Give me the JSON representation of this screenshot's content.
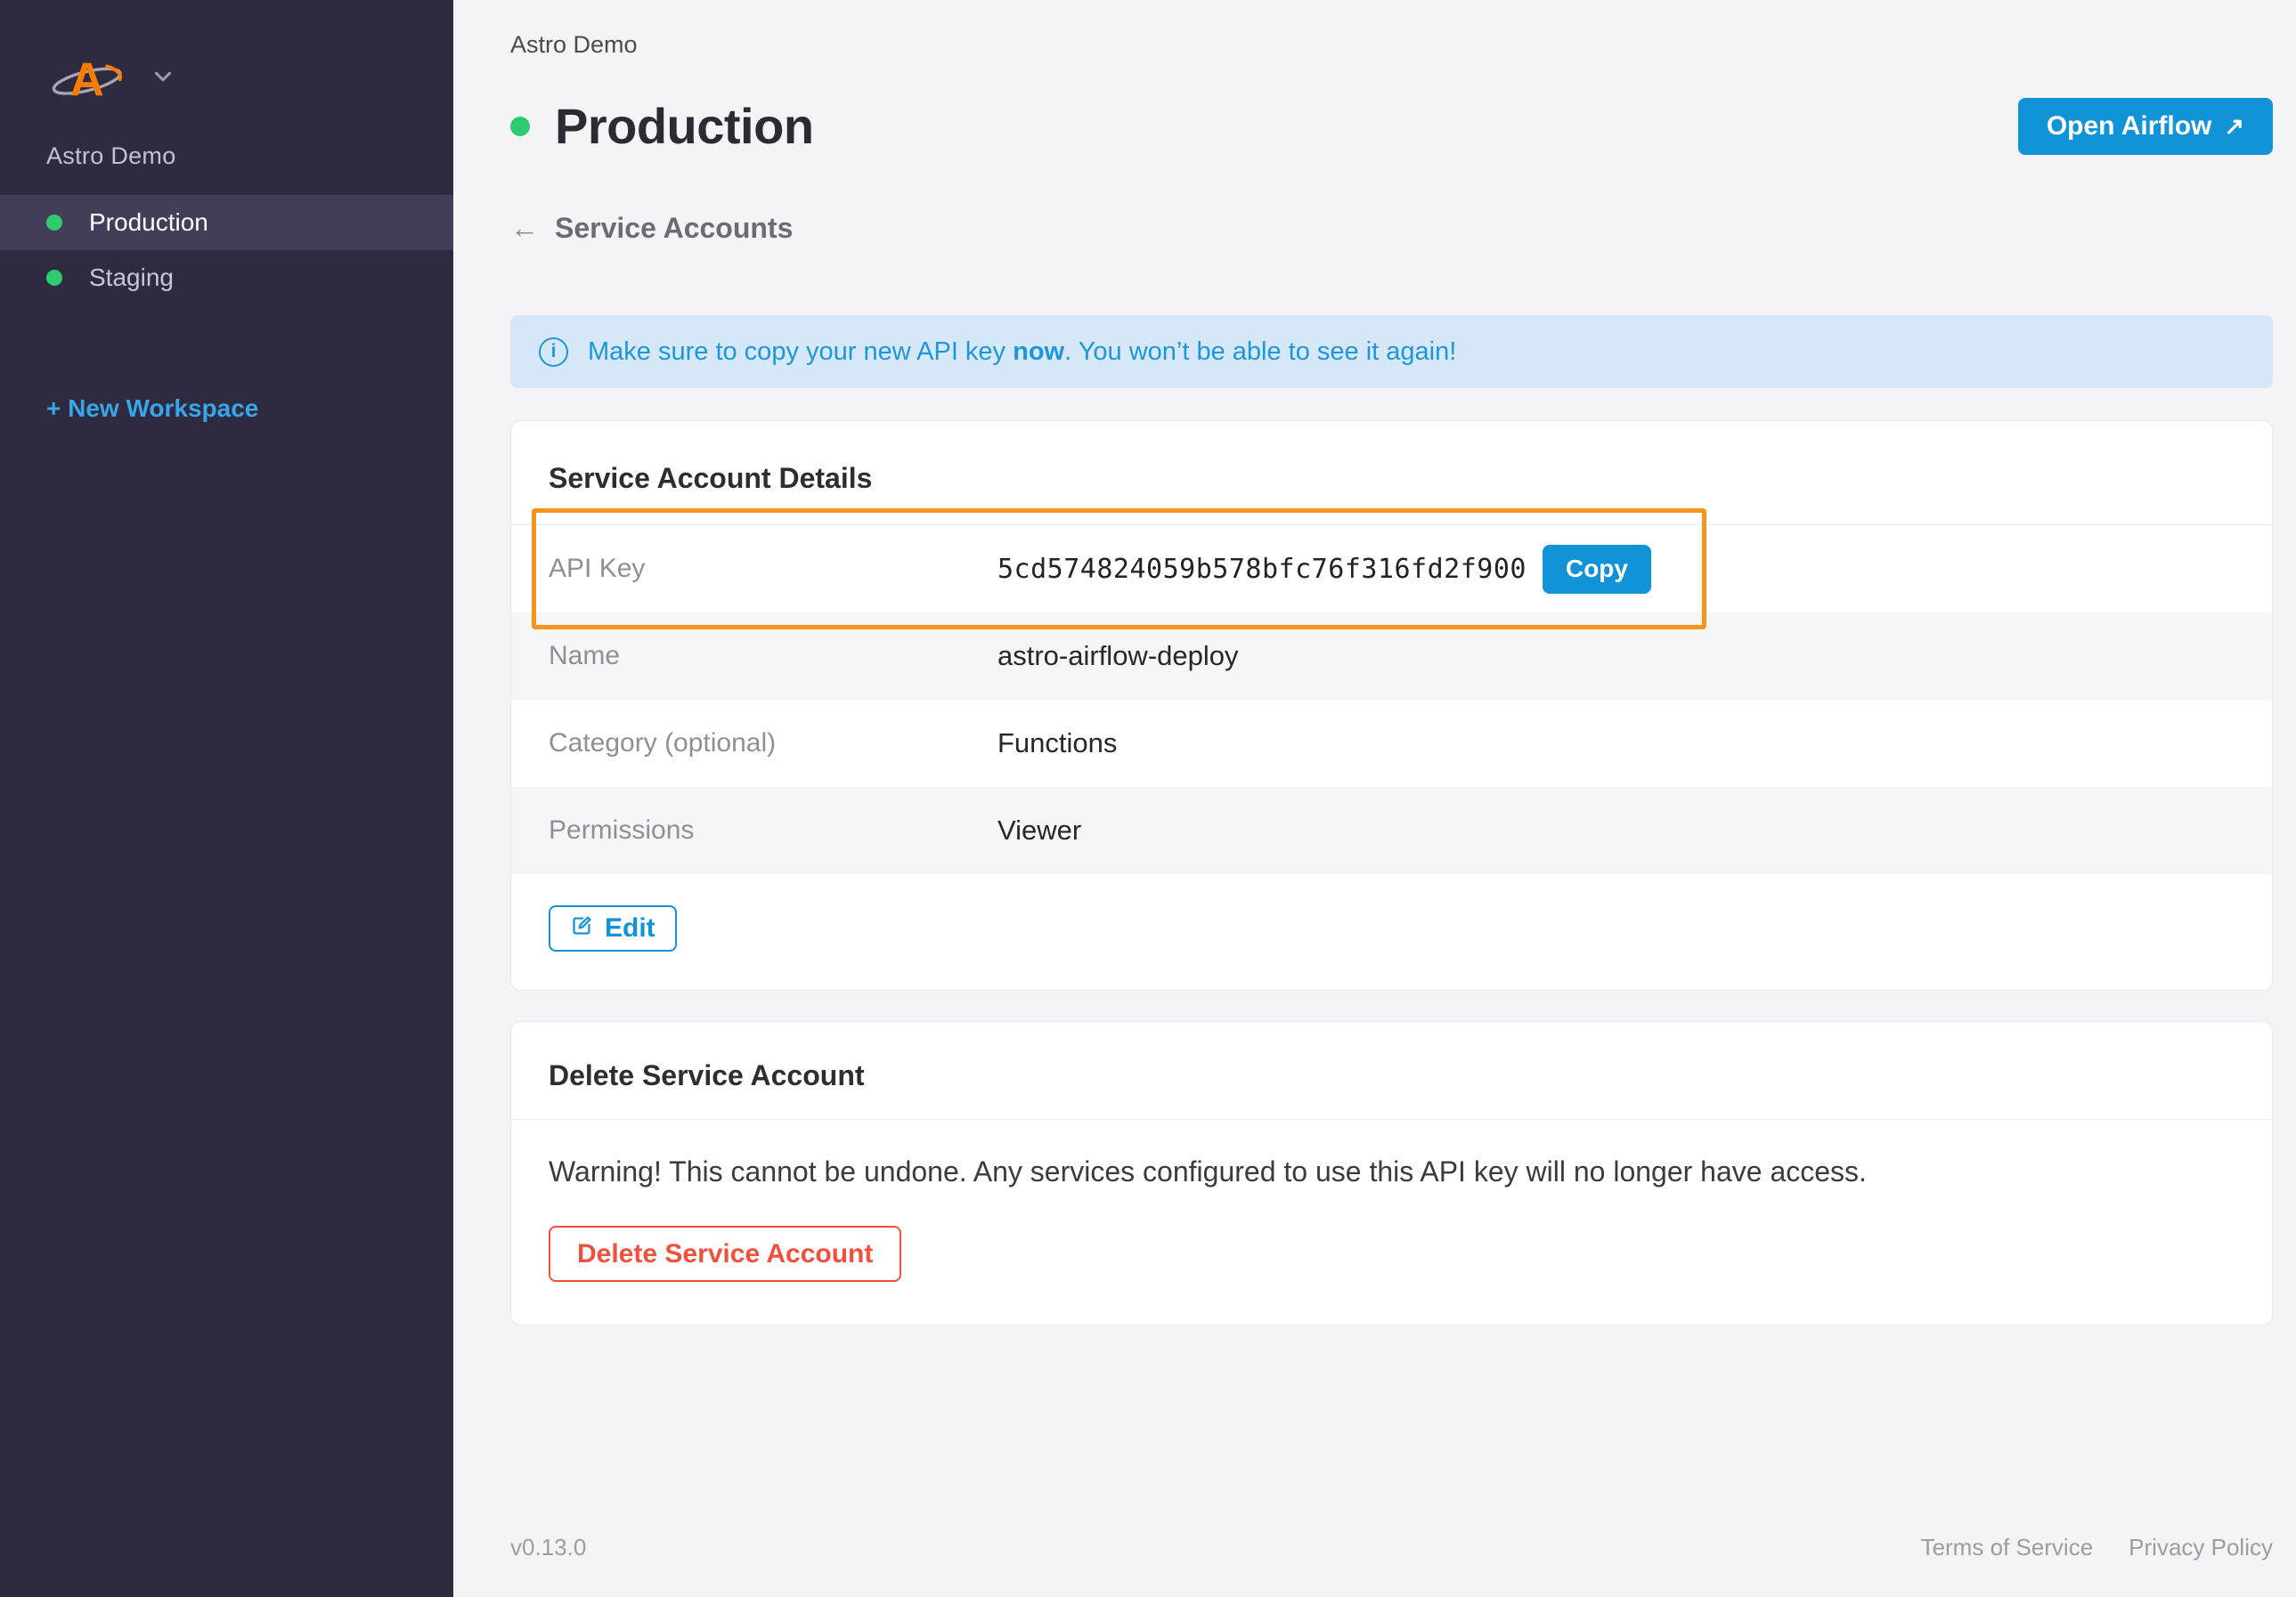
{
  "sidebar": {
    "workspace_name": "Astro Demo",
    "items": [
      {
        "label": "Production",
        "active": true
      },
      {
        "label": "Staging",
        "active": false
      }
    ],
    "new_workspace_label": "+ New Workspace"
  },
  "header": {
    "workspace_label": "Astro Demo",
    "page_title": "Production",
    "open_airflow_label": "Open Airflow",
    "open_airflow_icon": "↗",
    "back_icon": "←",
    "back_label": "Service Accounts"
  },
  "banner": {
    "icon": "i",
    "text_before": "Make sure to copy your new API key ",
    "text_bold": "now",
    "text_after": ". You won’t be able to see it again!"
  },
  "details_card": {
    "title": "Service Account Details",
    "rows": [
      {
        "label": "API Key",
        "value": "5cd574824059b578bfc76f316fd2f900"
      },
      {
        "label": "Name",
        "value": "astro-airflow-deploy"
      },
      {
        "label": "Category (optional)",
        "value": "Functions"
      },
      {
        "label": "Permissions",
        "value": "Viewer"
      }
    ],
    "copy_label": "Copy",
    "edit_label": "Edit"
  },
  "delete_card": {
    "title": "Delete Service Account",
    "warning": "Warning! This cannot be undone. Any services configured to use this API key will no longer have access.",
    "button_label": "Delete Service Account"
  },
  "footer": {
    "version": "v0.13.0",
    "links": [
      "Terms of Service",
      "Privacy Policy"
    ]
  },
  "colors": {
    "accent_blue": "#1193d8",
    "link_blue": "#38a6e9",
    "green": "#2fcb6f",
    "highlight_orange": "#f7941e",
    "danger_red": "#f1503c",
    "sidebar_bg": "#2e2a40",
    "banner_bg": "#d6e8f8"
  }
}
